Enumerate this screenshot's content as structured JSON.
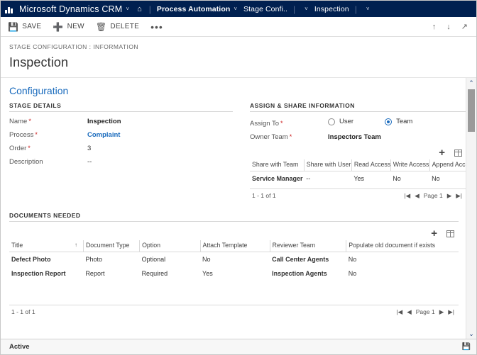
{
  "topnav": {
    "logo_icon": "dynamics-waffle-icon",
    "brand": "Microsoft Dynamics CRM",
    "brand_chevron": "˅",
    "home_icon": "⌂",
    "separator": "|",
    "items": [
      {
        "label": "Process Automation",
        "chevron": "˅"
      },
      {
        "label": "Stage Confi..",
        "chevron": "˅"
      },
      {
        "label": "Inspection",
        "chevron": "˅"
      }
    ]
  },
  "commandbar": {
    "save_label": "SAVE",
    "save_icon": "save-icon",
    "new_label": "NEW",
    "new_icon": "plus-icon",
    "delete_label": "DELETE",
    "delete_icon": "trash-icon",
    "more_label": "•••",
    "up_icon": "↑",
    "down_icon": "↓",
    "popout_icon": "↗"
  },
  "header": {
    "breadcrumb": "STAGE CONFIGURATION : INFORMATION",
    "title": "Inspection"
  },
  "section": {
    "title": "Configuration"
  },
  "stage_details": {
    "group_header": "STAGE  DETAILS",
    "fields": [
      {
        "label": "Name",
        "required": "*",
        "value": "Inspection",
        "style": "bold"
      },
      {
        "label": "Process",
        "required": "*",
        "value": "Complaint",
        "style": "link"
      },
      {
        "label": "Order",
        "required": "*",
        "value": "3",
        "style": "plain"
      },
      {
        "label": "Description",
        "required": "",
        "value": "--",
        "style": "plain"
      }
    ]
  },
  "assign_share": {
    "group_header": "ASSIGN & SHARE INFORMATION",
    "assign_to_label": "Assign To",
    "assign_to_required": "*",
    "options": [
      {
        "label": "User",
        "selected": false
      },
      {
        "label": "Team",
        "selected": true
      }
    ],
    "owner_team_label": "Owner Team",
    "owner_team_required": "*",
    "owner_team_value": "Inspectors Team",
    "add_icon": "plus-icon",
    "grid_icon": "grid-icon",
    "columns": [
      "Share with Team",
      "Share with User",
      "Read Access",
      "Write Access",
      "Append Access"
    ],
    "rows": [
      {
        "share_with_team": "Service Manager",
        "share_with_user": "--",
        "read_access": "Yes",
        "write_access": "No",
        "append_access": "No"
      }
    ],
    "pager": {
      "count": "1 - 1 of 1",
      "first": "|◀",
      "prev": "◀",
      "page": "Page 1",
      "next": "▶",
      "last": "▶|"
    }
  },
  "documents_needed": {
    "group_header": "DOCUMENTS NEEDED",
    "add_icon": "plus-icon",
    "grid_icon": "grid-icon",
    "sort_arrow": "↑",
    "columns": [
      "Title",
      "Document Type",
      "Option",
      "Attach Template",
      "Reviewer Team",
      "Populate old document if exists"
    ],
    "rows": [
      {
        "title": "Defect Photo",
        "document_type": "Photo",
        "option": "Optional",
        "attach_template": "No",
        "reviewer_team": "Call Center Agents",
        "populate_old": "No"
      },
      {
        "title": "Inspection Report",
        "document_type": "Report",
        "option": "Required",
        "attach_template": "Yes",
        "reviewer_team": "Inspection Agents",
        "populate_old": "No"
      }
    ],
    "pager": {
      "count": "1 - 1 of 1",
      "first": "|◀",
      "prev": "◀",
      "page": "Page 1",
      "next": "▶",
      "last": "▶|"
    }
  },
  "scrollbar": {
    "up_icon": "⌃",
    "down_icon": "⌄"
  },
  "statusbar": {
    "status": "Active",
    "save_icon": "save-icon"
  },
  "colors": {
    "navbar": "#002050",
    "link": "#1a6bbd",
    "required": "#cc2020",
    "section_title": "#1a6bbd"
  }
}
